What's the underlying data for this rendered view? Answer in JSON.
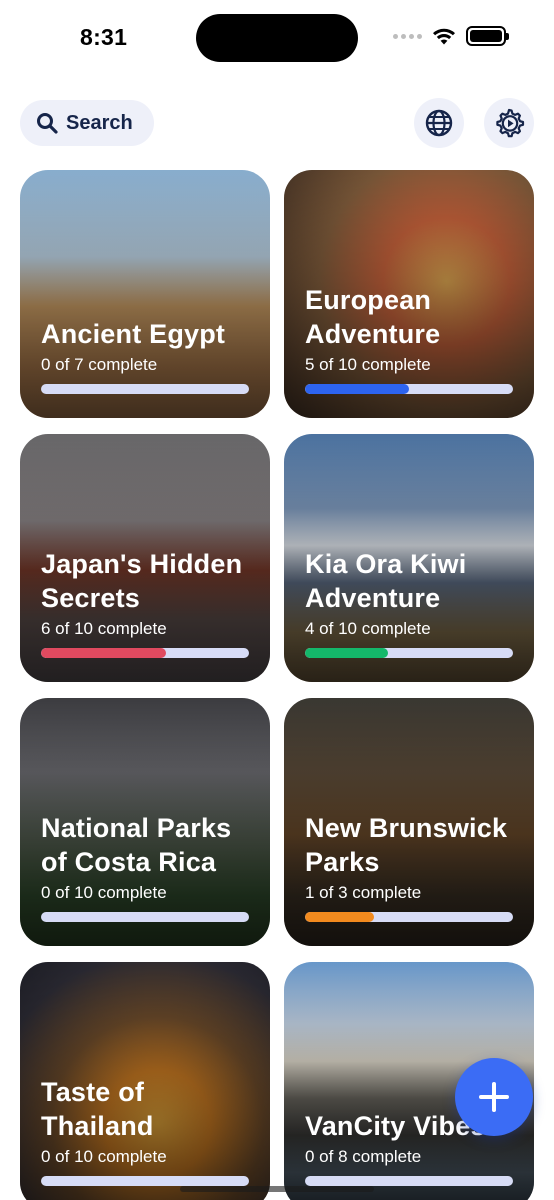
{
  "status_bar": {
    "time": "8:31"
  },
  "header": {
    "search_label": "Search",
    "search_icon": "search-icon",
    "globe_icon": "globe-icon",
    "settings_icon": "gear-play-icon"
  },
  "colors": {
    "pill_bg": "#eef0f9",
    "text_dark": "#16254a",
    "fab": "#3b6cf5",
    "track": "#d7dcf6"
  },
  "cards": [
    {
      "title": "Ancient Egypt",
      "progress_text": "0 of 7 complete",
      "progress": 0.0,
      "bar_color": "#3b6cf5",
      "bg": "linear-gradient(180deg,#8fb6d8 0%,#b9cfe0 35%,#c89b63 55%,#a9784a 80%,#8c6440 100%)"
    },
    {
      "title": "European Adventure",
      "progress_text": "5 of 10 complete",
      "progress": 0.5,
      "bar_color": "#2d64f0",
      "bg": "radial-gradient(circle at 65% 45%,#d9a34f 0%,#c2603a 30%,#7d5a3a 60%,#3d2d22 100%)"
    },
    {
      "title": "Japan's Hidden Secrets",
      "progress_text": "6 of 10 complete",
      "progress": 0.6,
      "bar_color": "#e04a5f",
      "bg": "linear-gradient(180deg,#6d6c6e 0%,#8a8486 35%,#7a3a2a 55%,#5b4d4a 75%,#4a4447 100%)"
    },
    {
      "title": "Kia Ora Kiwi Adventure",
      "progress_text": "4 of 10 complete",
      "progress": 0.4,
      "bar_color": "#14b86a",
      "bg": "linear-gradient(180deg,#4f78a8 0%,#7f9bbf 30%,#e6ecf3 45%,#5e6e86 60%,#7c6a48 80%,#5a4a32 100%)"
    },
    {
      "title": "National Parks of Costa Rica",
      "progress_text": "0 of 10 complete",
      "progress": 0.0,
      "bar_color": "#3b6cf5",
      "bg": "linear-gradient(180deg,#3f3f43 0%,#6a6a6f 30%,#4e5a4a 60%,#2f4a2c 80%,#23381f 100%)"
    },
    {
      "title": "New Brunswick Parks",
      "progress_text": "1 of 3 complete",
      "progress": 0.333,
      "bar_color": "#f28a1e",
      "bg": "linear-gradient(180deg,#3c3a34 0%,#5a4a38 30%,#6a4a2a 55%,#3a3024 80%,#2a231c 100%)"
    },
    {
      "title": "Taste of Thailand",
      "progress_text": "0 of 10 complete",
      "progress": 0.0,
      "bar_color": "#3b6cf5",
      "bg": "radial-gradient(circle at 55% 65%,#e2a53a 0%,#c97a22 25%,#6b4a2a 50%,#2b2a33 80%,#1d1e26 100%)"
    },
    {
      "title": "VanCity Vibes",
      "progress_text": "0 of 8 complete",
      "progress": 0.0,
      "bar_color": "#3b6cf5",
      "bg": "linear-gradient(180deg,#6c9ed4 0%,#c8d8ea 25%,#e8e2d4 40%,#6d6a62 55%,#3a3a38 70%,#4e5c68 85%,#2e3a44 100%)"
    }
  ],
  "fab": {
    "icon": "plus-icon"
  }
}
